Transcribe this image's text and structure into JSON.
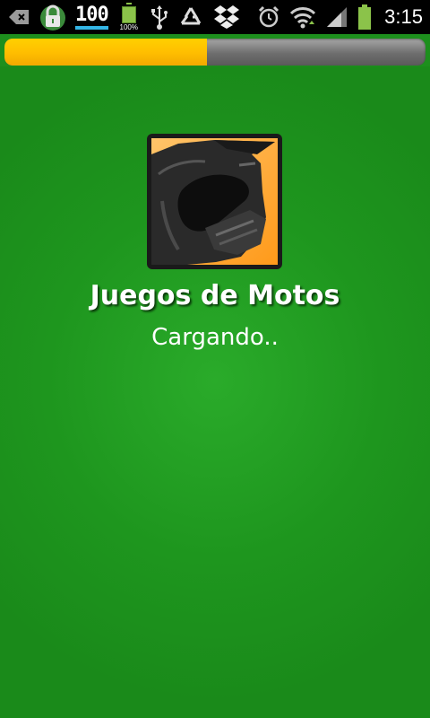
{
  "status_bar": {
    "icons": [
      "back-icon",
      "lock-icon",
      "signal-100-icon",
      "battery-small-icon",
      "usb-icon",
      "recycle-icon",
      "dropbox-icon",
      "alarm-icon",
      "wifi-icon",
      "cell-signal-icon",
      "battery-icon"
    ],
    "hundred_label": "100",
    "battery_percent_label": "100%",
    "time": "3:15",
    "colors": {
      "accent_blue": "#33b5e5",
      "battery_green": "#8bc34a"
    }
  },
  "progress": {
    "fraction": 0.48,
    "fill_color": "#ffbf00",
    "track_color": "#777777"
  },
  "splash": {
    "app_icon": "motorcycle-helmet-icon",
    "title": "Juegos de Motos",
    "status": "Cargando..",
    "background_color": "#1d8f1d"
  }
}
